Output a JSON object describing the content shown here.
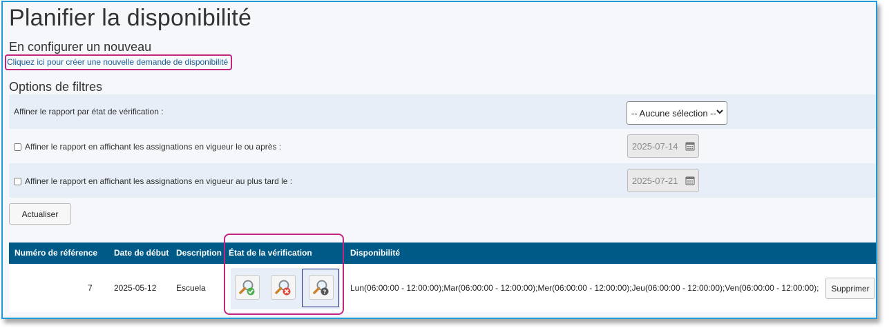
{
  "page": {
    "title": "Planifier la disponibilité",
    "create_section_title": "En configurer un nouveau",
    "create_link": "Cliquez ici pour créer une nouvelle demande de disponibilité",
    "filters_title": "Options de filtres"
  },
  "filters": {
    "status_label": "Affiner le rapport par état de vérification :",
    "status_select_value": "-- Aucune sélection --",
    "on_or_after_label": "Affiner le rapport en affichant les assignations en vigueur le ou après :",
    "on_or_after_date": "2025-07-14",
    "on_or_after_checked": false,
    "no_later_label": "Affiner le rapport en affichant les assignations en vigueur au plus tard le :",
    "no_later_date": "2025-07-21",
    "no_later_checked": false,
    "refresh_button": "Actualiser"
  },
  "table": {
    "headers": [
      "Numéro de référence",
      "Date de début",
      "Description",
      "État de la vérification",
      "Disponibilité"
    ],
    "rows": [
      {
        "reference": "7",
        "start_date": "2025-05-12",
        "description": "Escuela",
        "availability": "Lun(06:00:00 - 12:00:00);Mar(06:00:00 - 12:00:00);Mer(06:00:00 - 12:00:00);Jeu(06:00:00 - 12:00:00);Ven(06:00:00 - 12:00:00);",
        "delete_button": "Supprimer",
        "status_icons": [
          "approve-icon",
          "reject-icon",
          "pending-icon"
        ]
      }
    ]
  },
  "colors": {
    "header_bg": "#005a87",
    "highlight": "#c2247f",
    "frame_border": "#1e9bd7",
    "row_shade": "#e7eef7"
  }
}
